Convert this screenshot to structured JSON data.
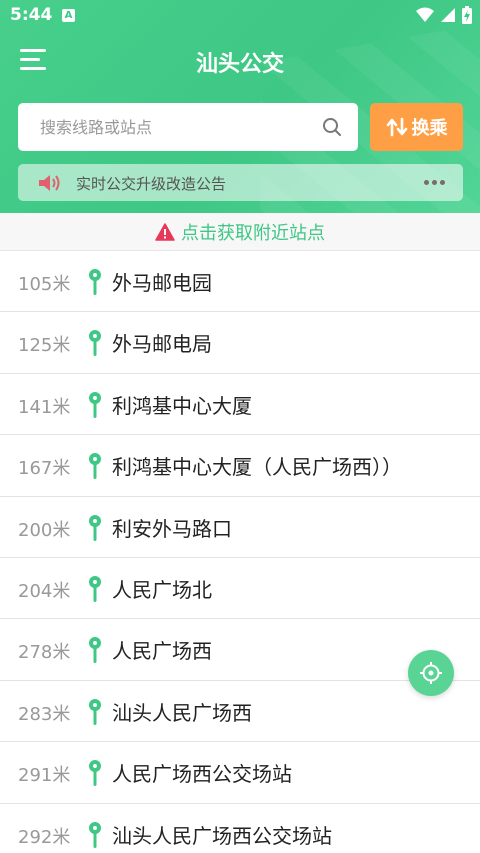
{
  "status_bar": {
    "time": "5:44",
    "notif": "A"
  },
  "header": {
    "title": "汕头公交"
  },
  "search": {
    "placeholder": "搜索线路或站点",
    "transfer_label": "换乘"
  },
  "notice": {
    "text": "实时公交升级改造公告"
  },
  "nearby": {
    "label": "点击获取附近站点"
  },
  "stops": [
    {
      "distance": "105米",
      "name": "外马邮电园"
    },
    {
      "distance": "125米",
      "name": "外马邮电局"
    },
    {
      "distance": "141米",
      "name": "利鸿基中心大厦"
    },
    {
      "distance": "167米",
      "name": "利鸿基中心大厦（人民广场西））"
    },
    {
      "distance": "200米",
      "name": "利安外马路口"
    },
    {
      "distance": "204米",
      "name": "人民广场北"
    },
    {
      "distance": "278米",
      "name": "人民广场西"
    },
    {
      "distance": "283米",
      "name": "汕头人民广场西"
    },
    {
      "distance": "291米",
      "name": "人民广场西公交场站"
    },
    {
      "distance": "292米",
      "name": "汕头人民广场西公交场站"
    }
  ],
  "colors": {
    "brand": "#3ec785",
    "accent": "#ff9f45",
    "warning": "#e8385a"
  },
  "icons": [
    "menu-icon",
    "search-icon",
    "transfer-icon",
    "speaker-icon",
    "more-icon",
    "warning-icon",
    "location-pin-icon",
    "locate-icon"
  ]
}
